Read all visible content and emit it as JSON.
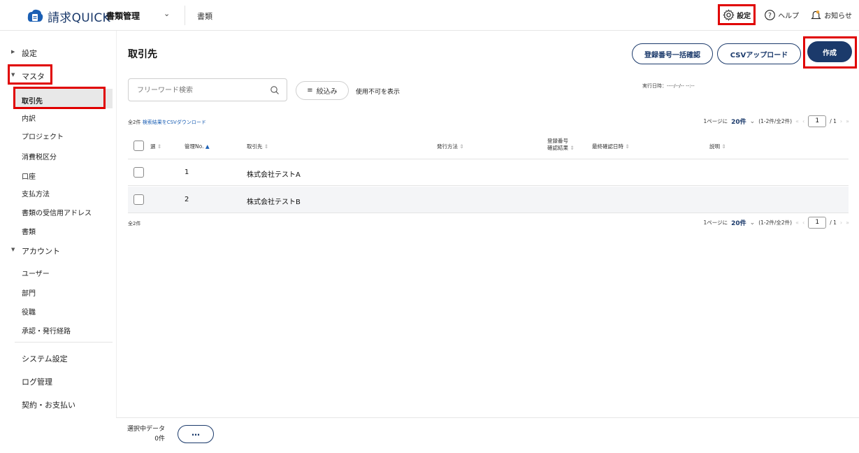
{
  "header": {
    "logo_text": "請求QUICK",
    "module": "書類管理",
    "submodule": "書類",
    "settings_label": "設定",
    "help_label": "ヘルプ",
    "notifications_label": "お知らせ"
  },
  "sidebar": {
    "settings": "設定",
    "master": "マスタ",
    "master_items": [
      "取引先",
      "内訳",
      "プロジェクト",
      "消費税区分",
      "口座",
      "支払方法",
      "書類の受信用アドレス",
      "書類"
    ],
    "account": "アカウント",
    "account_items": [
      "ユーザー",
      "部門",
      "役職",
      "承認・発行経路"
    ],
    "system_settings": "システム設定",
    "log_management": "ログ管理",
    "contract_payment": "契約・お支払い"
  },
  "main": {
    "title": "取引先",
    "bulk_check_button": "登録番号一括確認",
    "exec_date": "実行日時：----/--/-- --:--",
    "csv_upload_button": "CSVアップロード",
    "create_button": "作成",
    "search_placeholder": "フリーワード検索",
    "filter_button": "絞込み",
    "show_disabled": "使用不可を表示",
    "total_count": "全2件",
    "csv_download_link": "検索結果をCSVダウンロード",
    "per_page_prefix": "1ページに",
    "per_page_value": "20件",
    "range": "(1-2件/全2件)",
    "page_current": "1",
    "page_total": "/ 1"
  },
  "table": {
    "columns": {
      "select": "選",
      "mgmt_no": "管理No.",
      "partner": "取引先",
      "issue_method": "発行方法",
      "reg_no_line1": "登録番号",
      "reg_no_line2": "確認結果",
      "last_check": "最終確認日時",
      "description": "説明"
    },
    "rows": [
      {
        "no": "1",
        "partner": "株式会社テストA"
      },
      {
        "no": "2",
        "partner": "株式会社テストB"
      }
    ]
  },
  "footer": {
    "selected_label": "選択中データ",
    "selected_count": "0件",
    "more_button": "…"
  },
  "colors": {
    "brand": "#1b3a6b",
    "highlight": "#e00000",
    "link": "#1b5fb4"
  }
}
